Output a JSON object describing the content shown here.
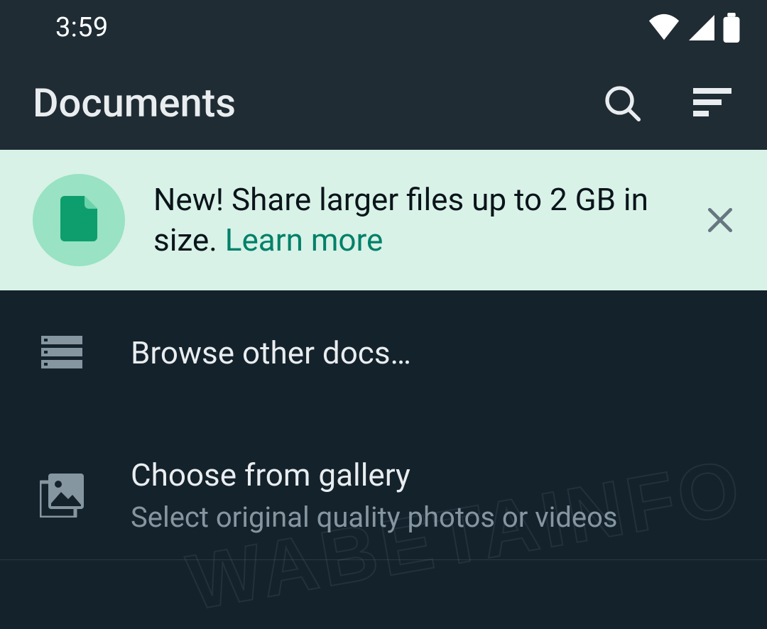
{
  "status": {
    "time": "3:59"
  },
  "header": {
    "title": "Documents"
  },
  "banner": {
    "text": "New! Share larger files up to 2 GB in size. ",
    "link": "Learn more"
  },
  "list": {
    "browse": {
      "title": "Browse other docs…"
    },
    "gallery": {
      "title": "Choose from gallery",
      "subtitle": "Select original quality photos or videos"
    }
  },
  "watermark": "WABETAINFO"
}
